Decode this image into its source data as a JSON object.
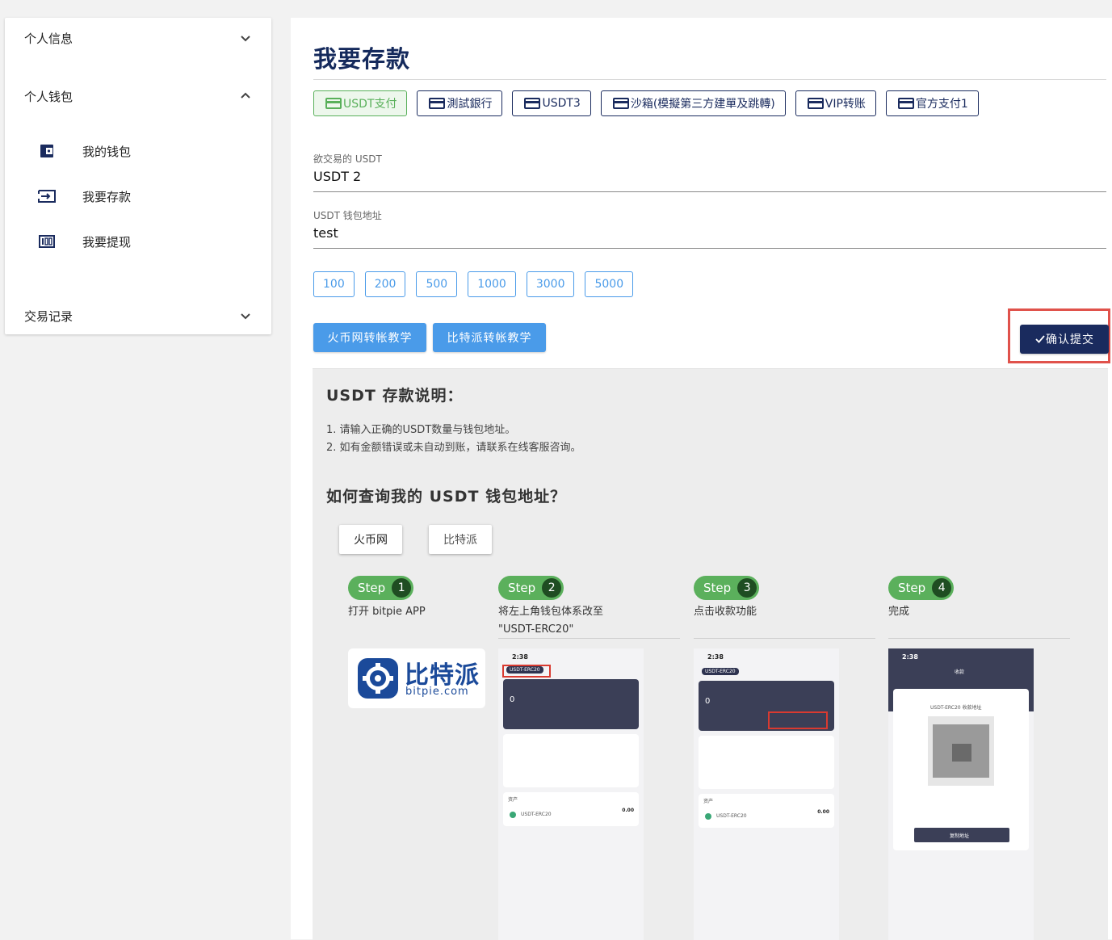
{
  "sidebar": {
    "personal_info": "个人信息",
    "wallet_group": "个人钱包",
    "items": [
      {
        "label": "我的钱包",
        "icon": "wallet-icon"
      },
      {
        "label": "我要存款",
        "icon": "deposit-icon"
      },
      {
        "label": "我要提现",
        "icon": "withdraw-icon"
      }
    ],
    "records": "交易记录"
  },
  "page": {
    "title": "我要存款",
    "tabs": [
      {
        "label": "USDT支付",
        "active": true
      },
      {
        "label": "測試銀行",
        "active": false
      },
      {
        "label": "USDT3",
        "active": false
      },
      {
        "label": "沙箱(模擬第三方建單及跳轉)",
        "active": false
      },
      {
        "label": "VIP转账",
        "active": false
      },
      {
        "label": "官方支付1",
        "active": false
      }
    ],
    "fields": {
      "amount_label": "欲交易的 USDT",
      "amount_value": "USDT 2",
      "address_label": "USDT 钱包地址",
      "address_value": "test"
    },
    "quick_amounts": [
      "100",
      "200",
      "500",
      "1000",
      "3000",
      "5000"
    ],
    "huobi_tutorial": "火币网转帐教学",
    "bitpie_tutorial": "比特派转帐教学",
    "confirm": "确认提交"
  },
  "guide": {
    "heading": "USDT 存款说明：",
    "notes": [
      "1. 请输入正确的USDT数量与钱包地址。",
      "2. 如有金额错误或未自动到账，请联系在线客服咨询。"
    ],
    "query_heading": "如何查询我的 USDT 钱包地址？",
    "exchanges": [
      "火币网",
      "比特派"
    ],
    "step_word": "Step",
    "steps": [
      {
        "num": "1",
        "desc": "打开 bitpie APP"
      },
      {
        "num": "2",
        "desc": "将左上角钱包体系改至 \"USDT-ERC20\""
      },
      {
        "num": "3",
        "desc": "点击收款功能"
      },
      {
        "num": "4",
        "desc": "完成"
      }
    ],
    "logo": {
      "cn": "比特派",
      "domain": "bitpie.com"
    },
    "phone": {
      "time": "2:38",
      "wallet_chip": "USDT-ERC20",
      "balance": "0",
      "asset_title": "资产",
      "asset_name": "USDT-ERC20",
      "asset_value": "0.00",
      "receive_title": "收款",
      "receive_card_title": "USDT-ERC20 收款地址",
      "copy_button": "复制地址"
    }
  },
  "colors": {
    "navy": "#1a2b5e",
    "green": "#5bb05c",
    "blue": "#4a9be9",
    "highlight": "#e0524b"
  }
}
